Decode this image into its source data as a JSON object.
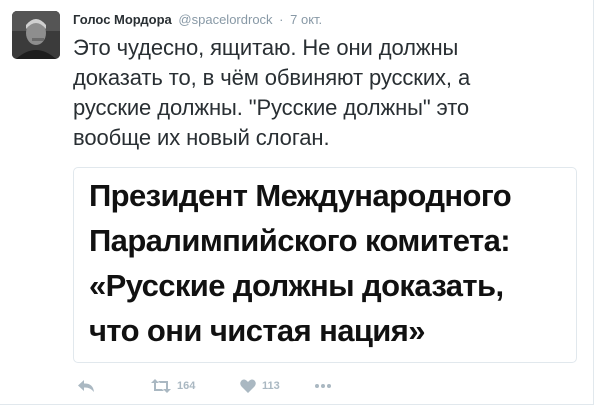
{
  "tweet": {
    "author": {
      "display_name": "Голос Мордора",
      "handle": "@spacelordrock"
    },
    "separator": "·",
    "timestamp": "7 окт.",
    "text_lines": [
      "Это чудесно, ящитаю. Не они должны",
      "доказать то, в чём обвиняют русских, а",
      "русские должны. \"Русские должны\" это",
      "вообще их новый слоган."
    ],
    "media": {
      "lines": [
        "Президент Международного",
        "Паралимпийского комитета:",
        "«Русские должны доказать,",
        "что они чистая нация»"
      ]
    },
    "actions": {
      "retweet_count": "164",
      "like_count": "113"
    },
    "icons": {
      "reply": "reply-icon",
      "retweet": "retweet-icon",
      "like": "heart-icon",
      "more": "more-icon"
    },
    "colors": {
      "text": "#292f33",
      "muted": "#8899a6",
      "action": "#aab8c2",
      "border": "#e1e8ed"
    }
  }
}
